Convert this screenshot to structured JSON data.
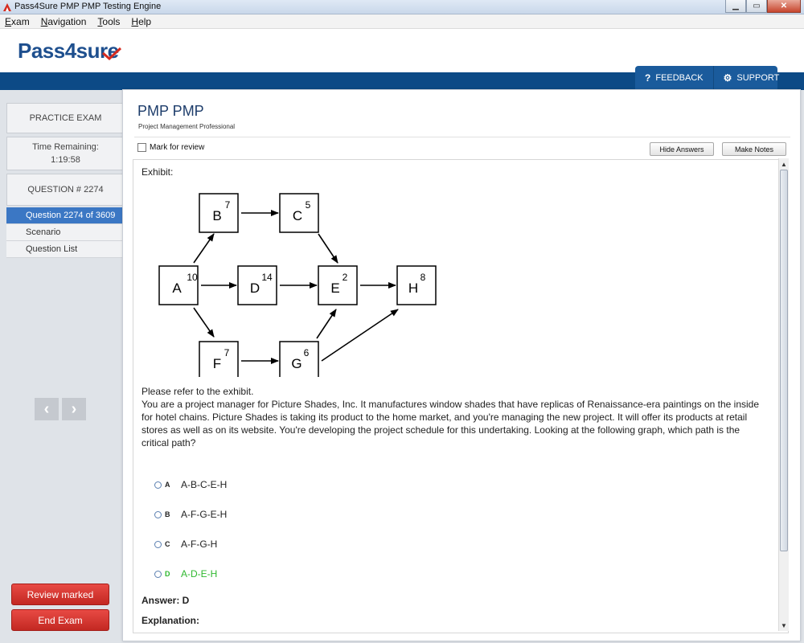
{
  "window": {
    "title": "Pass4Sure PMP PMP Testing Engine",
    "minimize": "▁",
    "maximize": "▭",
    "close": "✕"
  },
  "menu": [
    {
      "mnemonic": "E",
      "rest": "xam"
    },
    {
      "mnemonic": "N",
      "rest": "avigation"
    },
    {
      "mnemonic": "T",
      "rest": "ools"
    },
    {
      "mnemonic": "H",
      "rest": "elp"
    }
  ],
  "brand": {
    "logo_text": "Pass4sure"
  },
  "top_buttons": {
    "feedback_icon": "?",
    "feedback": "FEEDBACK",
    "support_icon": "⚙",
    "support": "SUPPORT"
  },
  "sidebar": {
    "practice_exam": "PRACTICE EXAM",
    "time_label": "Time Remaining:",
    "time_value": "1:19:58",
    "question_num": "QUESTION # 2274",
    "nav": [
      "Question 2274 of 3609",
      "Scenario",
      "Question List"
    ],
    "prev_arrow": "‹",
    "next_arrow": "›",
    "review_marked": "Review marked",
    "end_exam": "End Exam"
  },
  "exam": {
    "title": "PMP PMP",
    "subtitle": "Project Management Professional",
    "mark_for_review": "Mark for review",
    "hide_answers": "Hide Answers",
    "make_notes": "Make Notes"
  },
  "question": {
    "exhibit_label": "Exhibit:",
    "refer": "Please refer to the exhibit.",
    "body": "You are a project manager for Picture Shades, Inc. It manufactures window shades that have replicas of Renaissance-era paintings on the inside for hotel chains. Picture Shades is taking its product to the home market, and you're managing the new project. It will offer its products at retail stores as well as on its website. You're developing the project schedule for this undertaking. Looking at the following graph, which path is the critical path?",
    "options": [
      {
        "letter": "A",
        "text": "A-B-C-E-H",
        "correct": false
      },
      {
        "letter": "B",
        "text": "A-F-G-E-H",
        "correct": false
      },
      {
        "letter": "C",
        "text": "A-F-G-H",
        "correct": false
      },
      {
        "letter": "D",
        "text": "A-D-E-H",
        "correct": true
      }
    ],
    "answer": "Answer: D",
    "explanation": "Explanation:"
  },
  "network": {
    "nodes": [
      {
        "id": "A",
        "duration": "10"
      },
      {
        "id": "B",
        "duration": "7"
      },
      {
        "id": "C",
        "duration": "5"
      },
      {
        "id": "D",
        "duration": "14"
      },
      {
        "id": "E",
        "duration": "2"
      },
      {
        "id": "F",
        "duration": "7"
      },
      {
        "id": "G",
        "duration": "6"
      },
      {
        "id": "H",
        "duration": "8"
      }
    ]
  },
  "scroll": {
    "up": "▲",
    "down": "▼"
  },
  "colors": {
    "brand_blue": "#0c4a86",
    "active_nav": "#3b77c4",
    "danger_red": "#d8312b",
    "correct_green": "#2fb82f"
  }
}
